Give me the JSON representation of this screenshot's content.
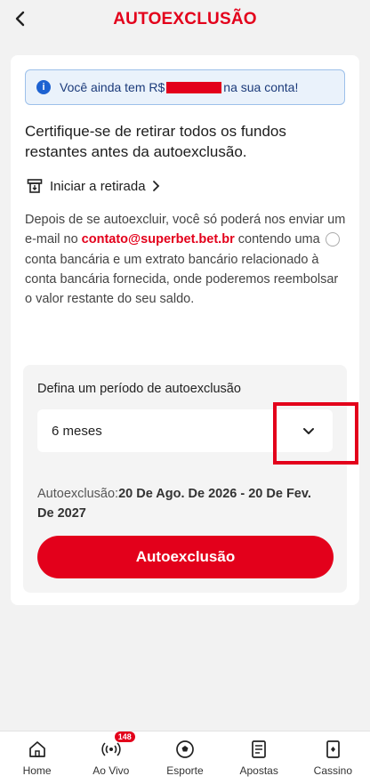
{
  "header": {
    "title": "AUTOEXCLUSÃO",
    "back_icon": "chevron-left-icon"
  },
  "banner": {
    "prefix": "Você ainda tem R$",
    "suffix": "na sua conta!"
  },
  "heading": "Certifique-se de retirar todos os fundos restantes antes da autoexclusão.",
  "withdraw_link": "Iniciar a retirada",
  "body": {
    "before": "Depois de se autoexcluir, você só poderá nos enviar um e-mail no",
    "email": "contato@superbet.bet.br",
    "after": "contendo uma conta bancária e um extrato bancário relacionado à conta bancária fornecida, onde poderemos reembolsar o valor restante do seu saldo."
  },
  "period": {
    "label": "Defina um período de autoexclusão",
    "selected": "6 meses",
    "dates_label": "Autoexclusão:",
    "dates_value": "20 De Ago. De 2026 - 20 De Fev. De 2027",
    "button": "Autoexclusão"
  },
  "nav": {
    "items": [
      {
        "label": "Home",
        "icon": "home-icon"
      },
      {
        "label": "Ao Vivo",
        "icon": "live-signal-icon",
        "badge": "148"
      },
      {
        "label": "Esporte",
        "icon": "soccer-ball-icon"
      },
      {
        "label": "Apostas",
        "icon": "betslip-icon"
      },
      {
        "label": "Cassino",
        "icon": "cards-icon"
      }
    ]
  },
  "colors": {
    "brand": "#e3001b",
    "info_bg": "#eaf2fb",
    "info_border": "#9dc0ea",
    "info_text": "#1b3a7a"
  }
}
